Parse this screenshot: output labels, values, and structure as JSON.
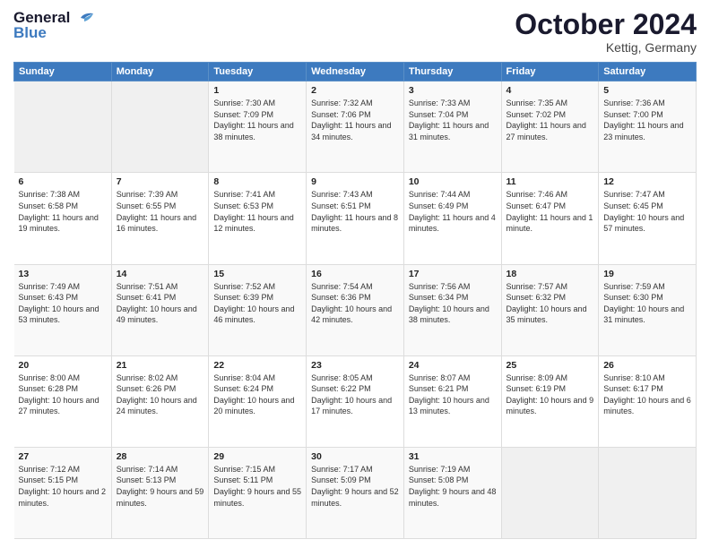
{
  "logo": {
    "line1": "General",
    "line2": "Blue"
  },
  "title": "October 2024",
  "location": "Kettig, Germany",
  "days_header": [
    "Sunday",
    "Monday",
    "Tuesday",
    "Wednesday",
    "Thursday",
    "Friday",
    "Saturday"
  ],
  "weeks": [
    [
      {
        "num": "",
        "sunrise": "",
        "sunset": "",
        "daylight": "",
        "empty": true
      },
      {
        "num": "",
        "sunrise": "",
        "sunset": "",
        "daylight": "",
        "empty": true
      },
      {
        "num": "1",
        "sunrise": "Sunrise: 7:30 AM",
        "sunset": "Sunset: 7:09 PM",
        "daylight": "Daylight: 11 hours and 38 minutes."
      },
      {
        "num": "2",
        "sunrise": "Sunrise: 7:32 AM",
        "sunset": "Sunset: 7:06 PM",
        "daylight": "Daylight: 11 hours and 34 minutes."
      },
      {
        "num": "3",
        "sunrise": "Sunrise: 7:33 AM",
        "sunset": "Sunset: 7:04 PM",
        "daylight": "Daylight: 11 hours and 31 minutes."
      },
      {
        "num": "4",
        "sunrise": "Sunrise: 7:35 AM",
        "sunset": "Sunset: 7:02 PM",
        "daylight": "Daylight: 11 hours and 27 minutes."
      },
      {
        "num": "5",
        "sunrise": "Sunrise: 7:36 AM",
        "sunset": "Sunset: 7:00 PM",
        "daylight": "Daylight: 11 hours and 23 minutes."
      }
    ],
    [
      {
        "num": "6",
        "sunrise": "Sunrise: 7:38 AM",
        "sunset": "Sunset: 6:58 PM",
        "daylight": "Daylight: 11 hours and 19 minutes."
      },
      {
        "num": "7",
        "sunrise": "Sunrise: 7:39 AM",
        "sunset": "Sunset: 6:55 PM",
        "daylight": "Daylight: 11 hours and 16 minutes."
      },
      {
        "num": "8",
        "sunrise": "Sunrise: 7:41 AM",
        "sunset": "Sunset: 6:53 PM",
        "daylight": "Daylight: 11 hours and 12 minutes."
      },
      {
        "num": "9",
        "sunrise": "Sunrise: 7:43 AM",
        "sunset": "Sunset: 6:51 PM",
        "daylight": "Daylight: 11 hours and 8 minutes."
      },
      {
        "num": "10",
        "sunrise": "Sunrise: 7:44 AM",
        "sunset": "Sunset: 6:49 PM",
        "daylight": "Daylight: 11 hours and 4 minutes."
      },
      {
        "num": "11",
        "sunrise": "Sunrise: 7:46 AM",
        "sunset": "Sunset: 6:47 PM",
        "daylight": "Daylight: 11 hours and 1 minute."
      },
      {
        "num": "12",
        "sunrise": "Sunrise: 7:47 AM",
        "sunset": "Sunset: 6:45 PM",
        "daylight": "Daylight: 10 hours and 57 minutes."
      }
    ],
    [
      {
        "num": "13",
        "sunrise": "Sunrise: 7:49 AM",
        "sunset": "Sunset: 6:43 PM",
        "daylight": "Daylight: 10 hours and 53 minutes."
      },
      {
        "num": "14",
        "sunrise": "Sunrise: 7:51 AM",
        "sunset": "Sunset: 6:41 PM",
        "daylight": "Daylight: 10 hours and 49 minutes."
      },
      {
        "num": "15",
        "sunrise": "Sunrise: 7:52 AM",
        "sunset": "Sunset: 6:39 PM",
        "daylight": "Daylight: 10 hours and 46 minutes."
      },
      {
        "num": "16",
        "sunrise": "Sunrise: 7:54 AM",
        "sunset": "Sunset: 6:36 PM",
        "daylight": "Daylight: 10 hours and 42 minutes."
      },
      {
        "num": "17",
        "sunrise": "Sunrise: 7:56 AM",
        "sunset": "Sunset: 6:34 PM",
        "daylight": "Daylight: 10 hours and 38 minutes."
      },
      {
        "num": "18",
        "sunrise": "Sunrise: 7:57 AM",
        "sunset": "Sunset: 6:32 PM",
        "daylight": "Daylight: 10 hours and 35 minutes."
      },
      {
        "num": "19",
        "sunrise": "Sunrise: 7:59 AM",
        "sunset": "Sunset: 6:30 PM",
        "daylight": "Daylight: 10 hours and 31 minutes."
      }
    ],
    [
      {
        "num": "20",
        "sunrise": "Sunrise: 8:00 AM",
        "sunset": "Sunset: 6:28 PM",
        "daylight": "Daylight: 10 hours and 27 minutes."
      },
      {
        "num": "21",
        "sunrise": "Sunrise: 8:02 AM",
        "sunset": "Sunset: 6:26 PM",
        "daylight": "Daylight: 10 hours and 24 minutes."
      },
      {
        "num": "22",
        "sunrise": "Sunrise: 8:04 AM",
        "sunset": "Sunset: 6:24 PM",
        "daylight": "Daylight: 10 hours and 20 minutes."
      },
      {
        "num": "23",
        "sunrise": "Sunrise: 8:05 AM",
        "sunset": "Sunset: 6:22 PM",
        "daylight": "Daylight: 10 hours and 17 minutes."
      },
      {
        "num": "24",
        "sunrise": "Sunrise: 8:07 AM",
        "sunset": "Sunset: 6:21 PM",
        "daylight": "Daylight: 10 hours and 13 minutes."
      },
      {
        "num": "25",
        "sunrise": "Sunrise: 8:09 AM",
        "sunset": "Sunset: 6:19 PM",
        "daylight": "Daylight: 10 hours and 9 minutes."
      },
      {
        "num": "26",
        "sunrise": "Sunrise: 8:10 AM",
        "sunset": "Sunset: 6:17 PM",
        "daylight": "Daylight: 10 hours and 6 minutes."
      }
    ],
    [
      {
        "num": "27",
        "sunrise": "Sunrise: 7:12 AM",
        "sunset": "Sunset: 5:15 PM",
        "daylight": "Daylight: 10 hours and 2 minutes."
      },
      {
        "num": "28",
        "sunrise": "Sunrise: 7:14 AM",
        "sunset": "Sunset: 5:13 PM",
        "daylight": "Daylight: 9 hours and 59 minutes."
      },
      {
        "num": "29",
        "sunrise": "Sunrise: 7:15 AM",
        "sunset": "Sunset: 5:11 PM",
        "daylight": "Daylight: 9 hours and 55 minutes."
      },
      {
        "num": "30",
        "sunrise": "Sunrise: 7:17 AM",
        "sunset": "Sunset: 5:09 PM",
        "daylight": "Daylight: 9 hours and 52 minutes."
      },
      {
        "num": "31",
        "sunrise": "Sunrise: 7:19 AM",
        "sunset": "Sunset: 5:08 PM",
        "daylight": "Daylight: 9 hours and 48 minutes."
      },
      {
        "num": "",
        "sunrise": "",
        "sunset": "",
        "daylight": "",
        "empty": true
      },
      {
        "num": "",
        "sunrise": "",
        "sunset": "",
        "daylight": "",
        "empty": true
      }
    ]
  ]
}
